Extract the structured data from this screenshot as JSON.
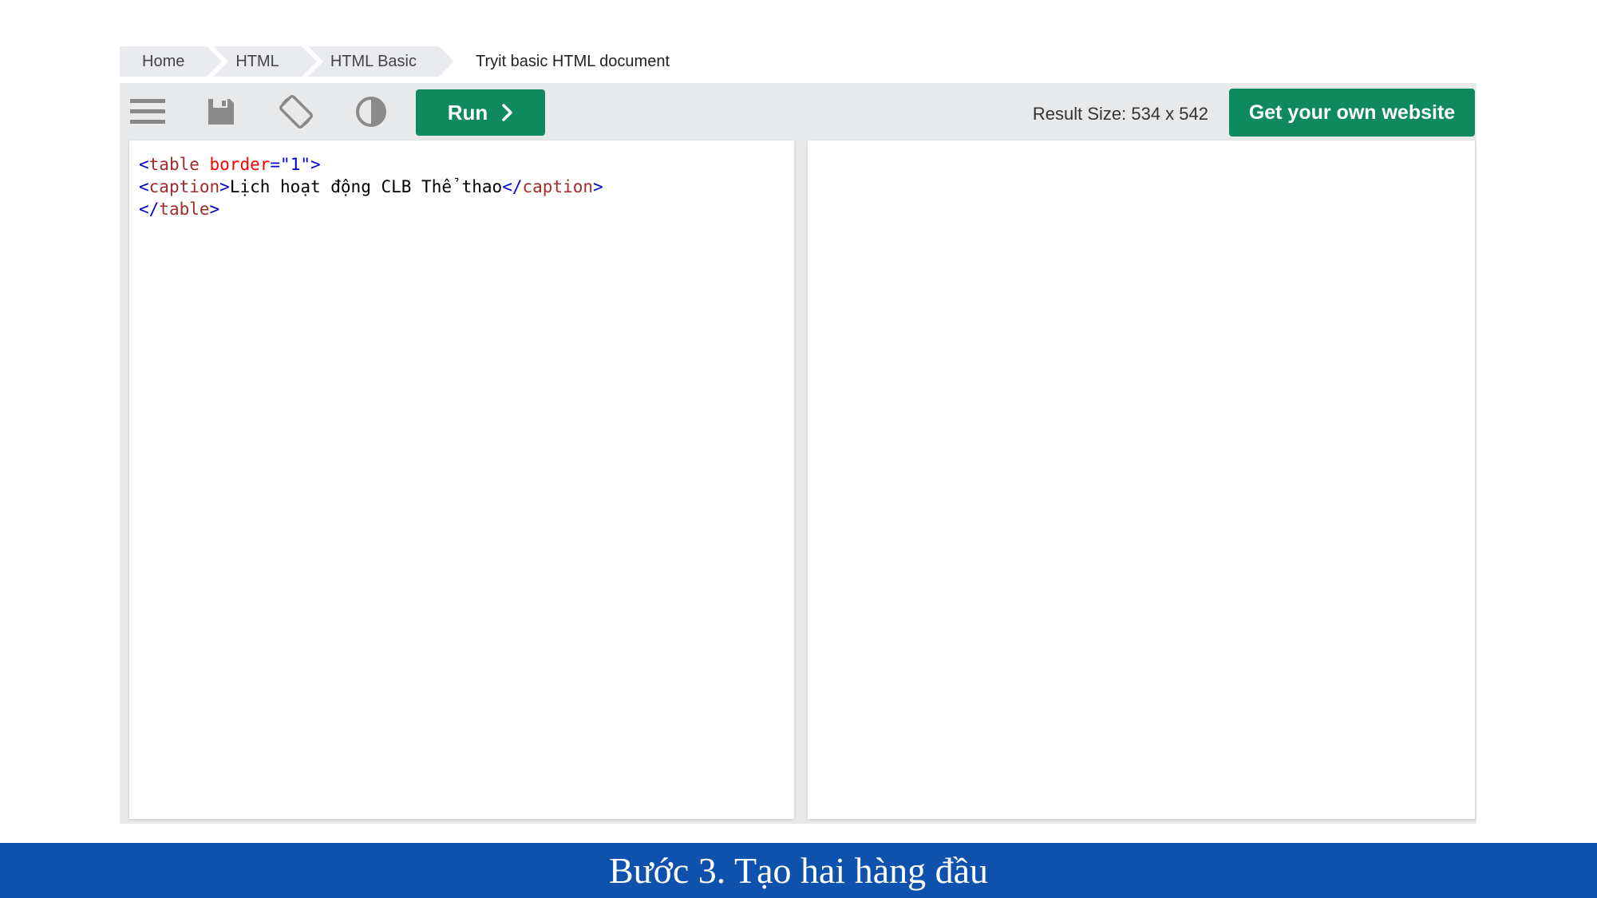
{
  "breadcrumb": {
    "items": [
      "Home",
      "HTML",
      "HTML Basic"
    ],
    "current": "Tryit basic HTML document"
  },
  "toolbar": {
    "icons": [
      "menu-icon",
      "save-icon",
      "rotate-icon",
      "contrast-icon"
    ],
    "run_label": "Run",
    "result_size": "Result Size: 534 x 542",
    "get_website_label": "Get your own website"
  },
  "editor": {
    "line1": {
      "open": "<",
      "tag": "table",
      "attr": " border",
      "eq": "=",
      "val": "\"1\"",
      "close": ">"
    },
    "line2": {
      "open": "<",
      "tag": "caption",
      "close": ">",
      "text": "Lịch hoạt động CLB Thể thao",
      "end_open": "</",
      "end_tag": "caption",
      "end_close": ">"
    },
    "line3": {
      "open": "</",
      "tag": "table",
      "close": ">"
    }
  },
  "caption_bar": {
    "text": "Bước 3. Tạo hai hàng đầu"
  },
  "colors": {
    "accent": "#0f8a5f",
    "caption_bg": "#0f52ae",
    "frame_bg": "#e7e9eb"
  }
}
